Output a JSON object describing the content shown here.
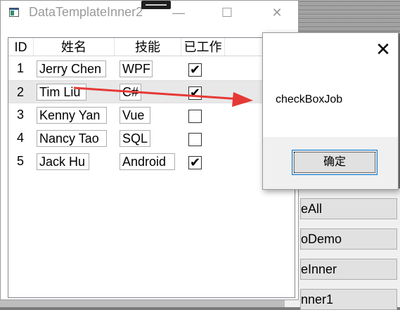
{
  "main_window": {
    "title": "DataTemplateInner2",
    "minimize": "—",
    "maximize": "☐",
    "close": "✕"
  },
  "grid": {
    "columns": [
      "ID",
      "姓名",
      "技能",
      "已工作"
    ],
    "rows": [
      {
        "id": "1",
        "name": "Jerry Chen",
        "skill": "WPF",
        "working": true
      },
      {
        "id": "2",
        "name": "Tim Liu",
        "skill": "C#",
        "working": true
      },
      {
        "id": "3",
        "name": "Kenny Yan",
        "skill": "Vue",
        "working": false
      },
      {
        "id": "4",
        "name": "Nancy Tao",
        "skill": "SQL",
        "working": false
      },
      {
        "id": "5",
        "name": "Jack Hu",
        "skill": "Android",
        "working": true
      }
    ]
  },
  "dialog": {
    "close": "✕",
    "message": "checkBoxJob",
    "ok_label": "确定"
  },
  "background_buttons": [
    "eAll",
    "oDemo",
    "eInner",
    "nner1"
  ],
  "colors": {
    "arrow": "#e53935",
    "selection": "#e8e8e8",
    "dialog_footer": "#f0f0f0"
  },
  "icons": {
    "check": "✔"
  }
}
